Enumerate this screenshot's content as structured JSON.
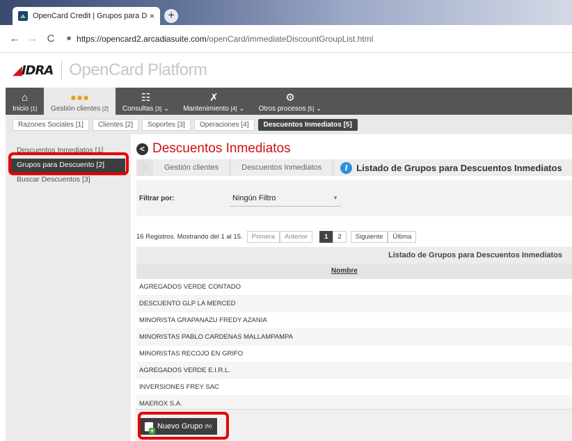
{
  "browser": {
    "tab_title": "OpenCard Credit | Grupos para D",
    "tab_close": "×",
    "new_tab": "+",
    "back": "←",
    "forward": "→",
    "reload": "C",
    "url_host": "https://opencard2.arcadiasuite.com",
    "url_path": "/openCard/immediateDiscountGroupList.html"
  },
  "header": {
    "logo_text": "IDRA",
    "platform": "OpenCard Platform"
  },
  "mainnav": [
    {
      "label": "Inicio",
      "key": "[1]",
      "icon": "home-icon",
      "glyph": "⌂"
    },
    {
      "label": "Gestión clientes",
      "key": "[2]",
      "icon": "users-icon",
      "glyph": "👥"
    },
    {
      "label": "Consultas",
      "key": "[3]",
      "icon": "chart-icon",
      "glyph": "📊",
      "dropdown": "⌄"
    },
    {
      "label": "Mantenimiento",
      "key": "[4]",
      "icon": "wrench-icon",
      "glyph": "🔧",
      "dropdown": "⌄"
    },
    {
      "label": "Otros procesos",
      "key": "[5]",
      "icon": "gear-icon",
      "glyph": "⚙",
      "dropdown": "⌄"
    }
  ],
  "subnav": [
    {
      "label": "Razones Sociales",
      "key": "[1]"
    },
    {
      "label": "Clientes",
      "key": "[2]"
    },
    {
      "label": "Soportes",
      "key": "[3]"
    },
    {
      "label": "Operaciones",
      "key": "[4]"
    },
    {
      "label": "Descuentos Inmediatos",
      "key": "[5]"
    }
  ],
  "sidebar": [
    {
      "label": "Descuentos Inmediatos",
      "key": "[1]"
    },
    {
      "label": "Grupos para Descuento",
      "key": "[2]"
    },
    {
      "label": "Buscar Descuentos",
      "key": "[3]"
    }
  ],
  "page": {
    "back_glyph": "<",
    "title": "Descuentos Inmediatos",
    "home_glyph": "⌂",
    "breadcrumb": [
      "Gestión clientes",
      "Descuentos Inmediatos"
    ],
    "info_glyph": "i",
    "breadcrumb_current": "Listado de Grupos para Descuentos Inmediatos"
  },
  "filter": {
    "label": "Filtrar por:",
    "value": "Ningún Filtro",
    "caret": "▼"
  },
  "pager": {
    "info": "16 Registros. Mostrando del 1 al 15.",
    "first": "Primera",
    "prev": "Anterior",
    "page1": "1",
    "page2": "2",
    "next": "Siguiente",
    "last": "Última"
  },
  "table": {
    "caption": "Listado de Grupos para Descuentos Inmediatos",
    "column": "Nombre",
    "rows": [
      "AGREGADOS VERDE CONTADO",
      "DESCUENTO GLP LA MERCED",
      "MINORISTA GRAPANAZU FREDY AZANIA",
      "MINORISTAS PABLO CARDENAS MALLAMPAMPA",
      "MINORISTAS RECOJO EN GRIFO",
      "AGREGADOS VERDE E.I.R.L.",
      "INVERSIONES FREY SAC",
      "MAEROX S.A."
    ]
  },
  "footer": {
    "new_button": "Nuevo Grupo",
    "new_key": "(N)"
  },
  "colors": {
    "highlight": "#e60000",
    "title_red": "#d01010",
    "nav_dark": "#555555",
    "info_blue": "#2f8fdc"
  }
}
